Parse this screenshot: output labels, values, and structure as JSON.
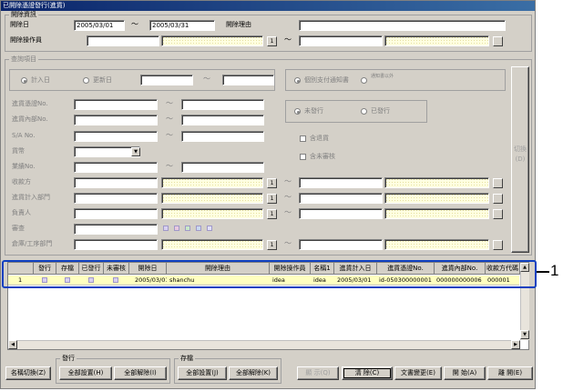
{
  "window": {
    "title": "已開除憑證發行(進貨)"
  },
  "delete_info": {
    "group_label": "開除資訊",
    "date_label": "開除日",
    "date_from": "2005/03/01",
    "tilde": "〜",
    "date_to": "2005/03/31",
    "reason_label": "開除理由",
    "operator_label": "開除操作員",
    "btn1": "1"
  },
  "query": {
    "group_label": "查詢項目",
    "radio_entry_date": "計入日",
    "radio_update_date": "更新日",
    "radio_individual": "個別支付通知書",
    "radio_other": "通知書以外",
    "voucher_no": "進貨憑證No.",
    "internal_no": "進貨內部No.",
    "sa_no": "S/A No.",
    "currency": "貨幣",
    "ref_no": "業績No.",
    "payee": "收款方",
    "dept": "進貨計入部門",
    "owner": "負責人",
    "review": "審查",
    "warehouse": "倉庫/工序部門",
    "radio_unissued": "未發行",
    "radio_issued": "已發行",
    "chk_returned": "含退貨",
    "chk_unreviewed": "含未審核",
    "switch_label": "切換(D)",
    "btn1": "1"
  },
  "table": {
    "columns": [
      "發行",
      "存檔",
      "已發行",
      "未審核",
      "開除日",
      "開除理由",
      "開除操作員",
      "名稱1",
      "進貨計入日",
      "進貨憑證No.",
      "進貨內部No.",
      "收款方代碼"
    ],
    "rows": [
      [
        "1",
        "",
        "",
        "",
        "",
        "2005/03/01",
        "shanchu",
        "idea",
        "idea",
        "2005/03/01",
        "id-050300000001",
        "000000000006",
        "000001"
      ]
    ]
  },
  "callout": {
    "number": "1"
  },
  "footer": {
    "toggle_name": "名稱切換(Z)",
    "issue_group": "發行",
    "issue_select_all": "全部設置(H)",
    "issue_clear_all": "全部解除(I)",
    "save_group": "存檔",
    "save_select_all": "全部設置(J)",
    "save_clear_all": "全部解除(K)",
    "display": "顯 示(Q)",
    "clear": "清 除(C)",
    "doc_change": "文書變更(E)",
    "start": "開 始(A)",
    "close": "離 開(E)"
  }
}
